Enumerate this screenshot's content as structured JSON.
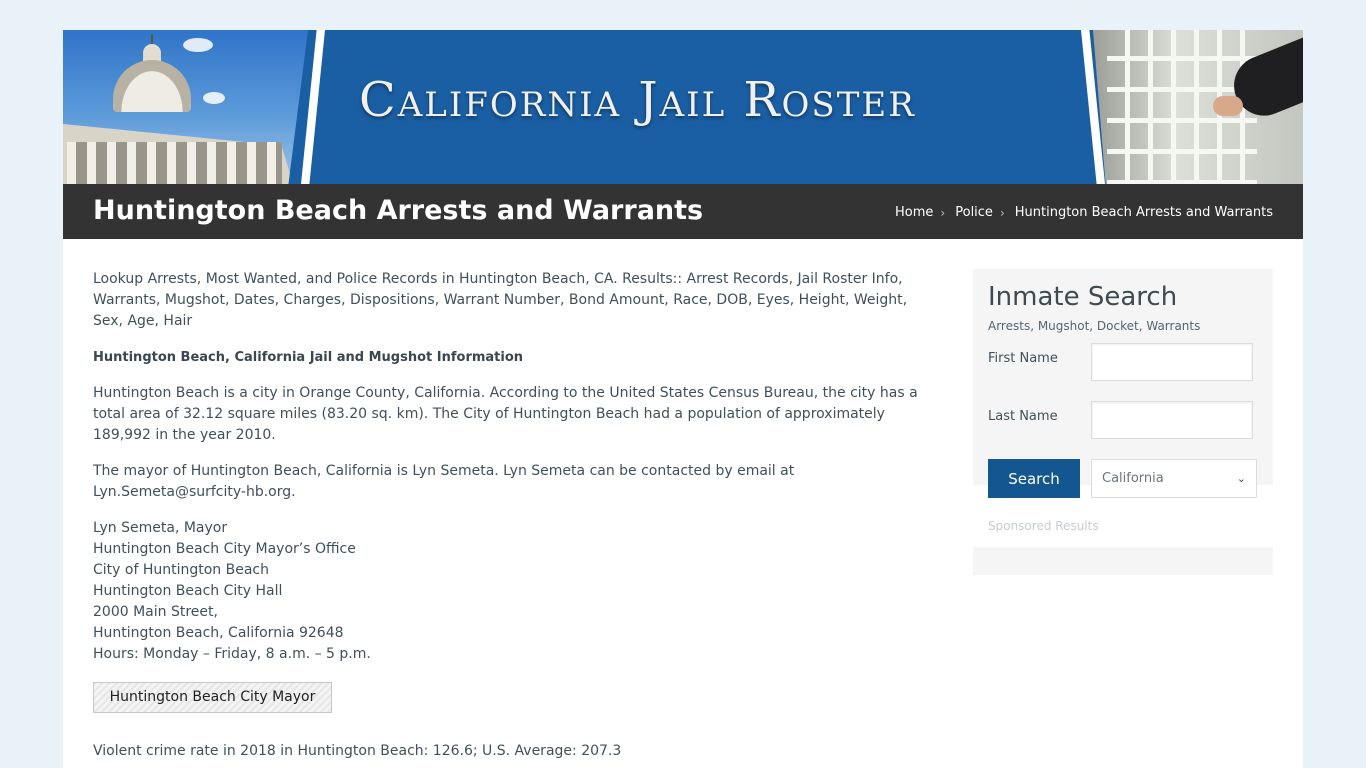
{
  "banner": {
    "site_title": "California Jail Roster"
  },
  "titlebar": {
    "page_title": "Huntington Beach Arrests and Warrants",
    "breadcrumb": [
      {
        "label": "Home"
      },
      {
        "label": "Police"
      },
      {
        "label": "Huntington Beach Arrests and Warrants"
      }
    ]
  },
  "main": {
    "intro": "Lookup Arrests, Most Wanted, and Police Records in Huntington Beach, CA. Results:: Arrest Records, Jail Roster Info, Warrants, Mugshot, Dates, Charges, Dispositions, Warrant Number, Bond Amount, Race, DOB, Eyes, Height, Weight, Sex, Age, Hair",
    "subheading": "Huntington Beach, California Jail and Mugshot Information",
    "city_info": "Huntington Beach is a city in Orange County, California. According to the United States Census Bureau, the city has a total area of 32.12 square miles (83.20 sq. km). The City of Huntington Beach had a population of approximately 189,992 in the year 2010.",
    "mayor_info": "The mayor of Huntington Beach, California is Lyn Semeta. Lyn Semeta can be contacted by email at Lyn.Semeta@surfcity-hb.org.",
    "address": [
      "Lyn Semeta, Mayor",
      "Huntington Beach City Mayor’s Office",
      "City of Huntington Beach",
      "Huntington Beach City Hall",
      "2000 Main Street,",
      "Huntington Beach, California 92648",
      "Hours: Monday – Friday, 8 a.m. – 5 p.m."
    ],
    "mayor_button": "Huntington Beach City Mayor",
    "crime_2018": "Violent crime rate in 2018 in Huntington Beach: 126.6; U.S. Average: 207.3"
  },
  "sidebar": {
    "title": "Inmate Search",
    "subtitle": "Arrests, Mugshot, Docket, Warrants",
    "first_name_label": "First Name",
    "first_name_value": "",
    "last_name_label": "Last Name",
    "last_name_value": "",
    "search_button": "Search",
    "state_selected": "California",
    "sponsored": "Sponsored Results"
  },
  "colors": {
    "banner_blue": "#1a5ea3",
    "title_bar": "#333333",
    "search_button": "#145790",
    "page_background": "#e8f2f8"
  }
}
